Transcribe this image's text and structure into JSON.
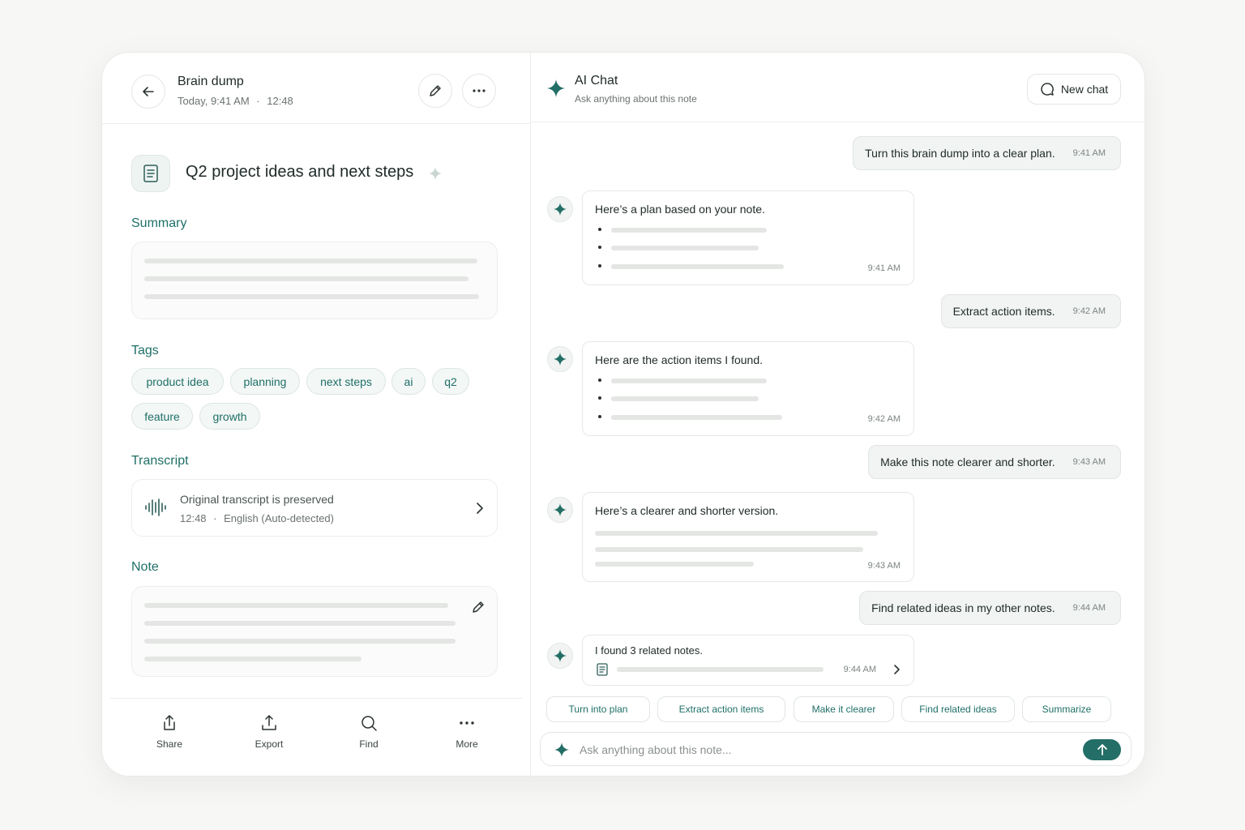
{
  "note": {
    "title": "Brain dump",
    "date": "Today, 9:41 AM",
    "duration": "12:48",
    "doc_title": "Q2 project ideas and next steps",
    "summary_label": "Summary",
    "tags_label": "Tags",
    "tags": [
      "product idea",
      "planning",
      "next steps",
      "ai",
      "q2",
      "feature",
      "growth"
    ],
    "transcript_label": "Transcript",
    "transcript_text": "Original transcript is preserved",
    "transcript_duration": "12:48",
    "transcript_language": "English (Auto-detected)",
    "note_label": "Note"
  },
  "toolbar": {
    "share": "Share",
    "export": "Export",
    "find": "Find",
    "more": "More"
  },
  "chat": {
    "title": "AI Chat",
    "subtitle": "Ask anything about this note",
    "new_chat": "New chat",
    "messages": [
      {
        "role": "user",
        "text": "Turn this brain dump into a clear plan.",
        "time": "9:41 AM"
      },
      {
        "role": "ai",
        "text": "Here’s a plan based on your note.",
        "time": "9:41 AM"
      },
      {
        "role": "user",
        "text": "Extract action items.",
        "time": "9:42 AM"
      },
      {
        "role": "ai",
        "text": "Here are the action items I found.",
        "time": "9:42 AM"
      },
      {
        "role": "user",
        "text": "Make this note clearer and shorter.",
        "time": "9:43 AM"
      },
      {
        "role": "ai",
        "text": "Here’s a clearer and shorter version.",
        "time": "9:43 AM"
      },
      {
        "role": "user",
        "text": "Find related ideas in my other notes.",
        "time": "9:44 AM"
      },
      {
        "role": "ai",
        "text": "I found 3 related notes.",
        "time": "9:44 AM"
      }
    ],
    "suggestions": [
      "Turn into plan",
      "Extract action items",
      "Make it clearer",
      "Find related ideas",
      "Summarize"
    ],
    "input_placeholder": "Ask anything about this note..."
  },
  "colors": {
    "accent": "#236e66",
    "accent_text": "#1f6f68",
    "skeleton": "#e4e6e4"
  }
}
